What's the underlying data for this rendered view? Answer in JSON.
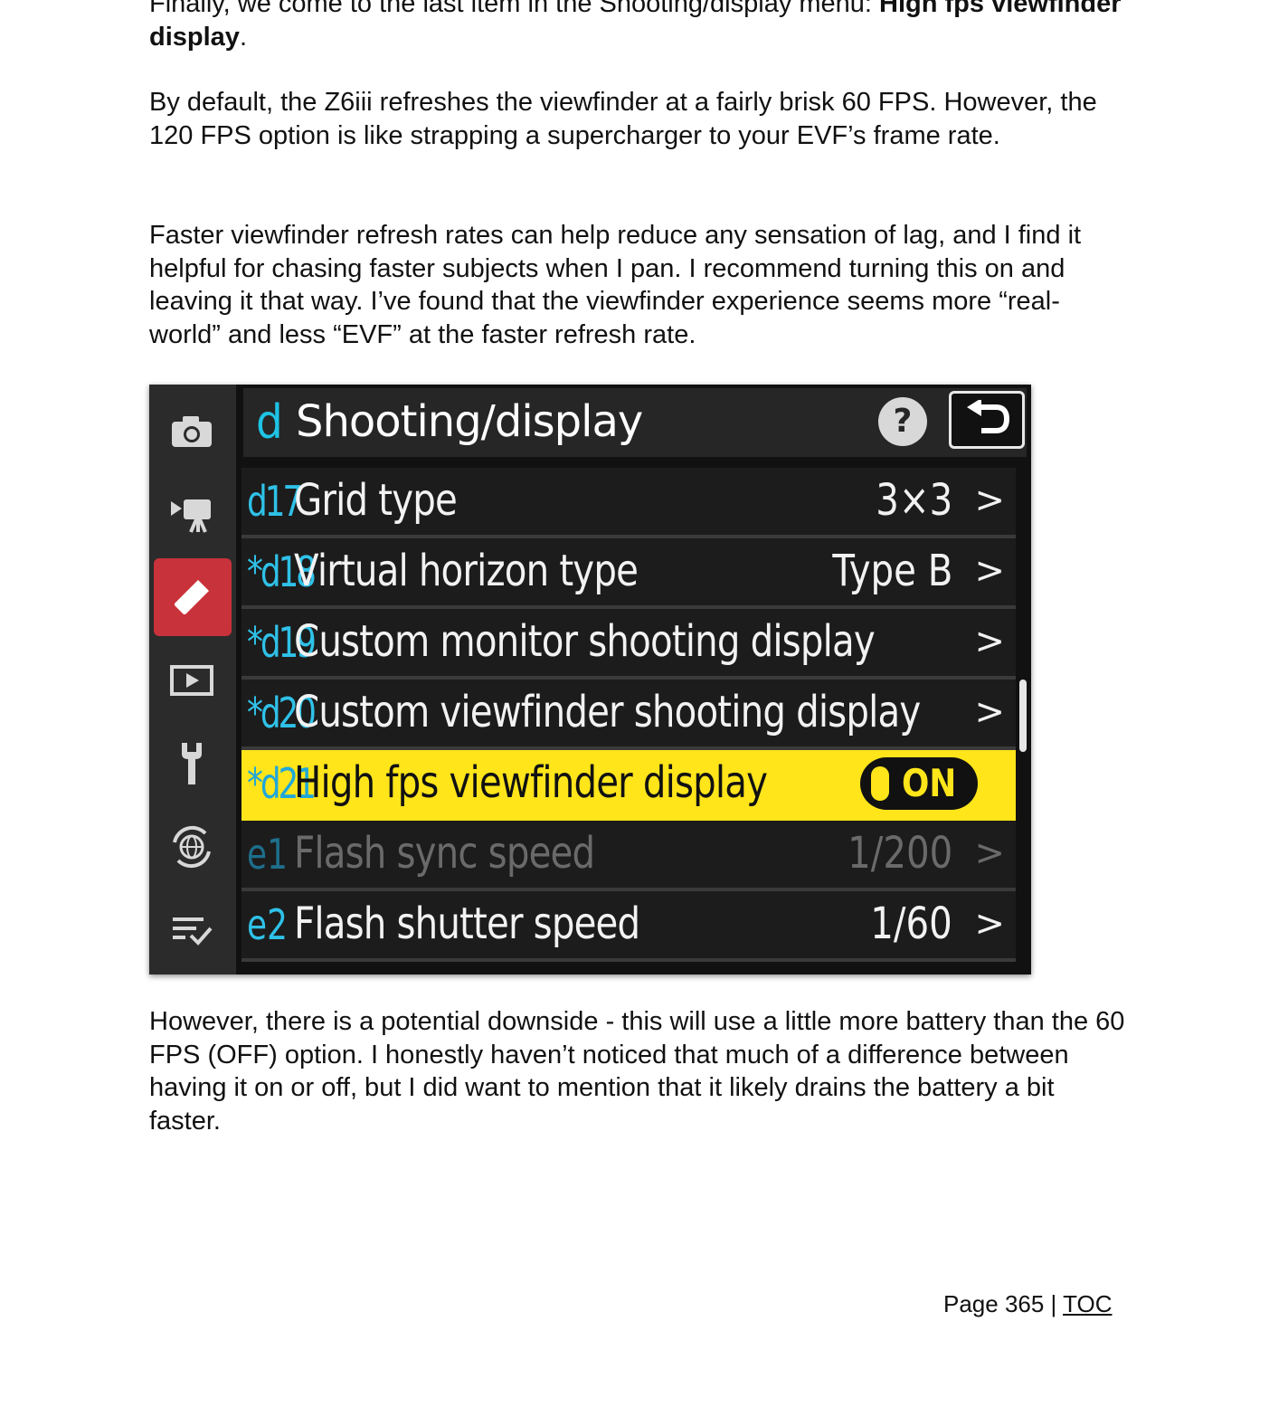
{
  "paragraphs": {
    "p0_pre": "Finally, we come to the last item in the Shooting/display menu: ",
    "p0_bold": "High fps viewfinder display",
    "p0_post": ".",
    "p1": "By default, the Z6iii refreshes the viewfinder at a fairly brisk 60 FPS. However, the 120 FPS option is like strapping a supercharger to your EVF’s frame rate.",
    "p2": "Faster viewfinder refresh rates can help reduce any sensation of lag, and I find it helpful for chasing faster subjects when I pan. I recommend turning this on and leaving it that way. I’ve found that the viewfinder experience seems more “real-world” and less “EVF” at the faster refresh rate.",
    "p3": "However, there is a potential downside - this will use a little more battery than the 60 FPS (OFF) option. I honestly haven’t noticed that much of a difference between having it on or off, but I did want to mention that it likely drains the battery a bit faster."
  },
  "menu": {
    "header_letter": "d",
    "header_title": "Shooting/display",
    "help_label": "?",
    "rail_icons": [
      "camera-icon",
      "movie-camera-icon",
      "pencil-icon",
      "playback-icon",
      "wrench-icon",
      "network-icon",
      "my-menu-icon"
    ],
    "active_rail_icon": "pencil-icon",
    "rows": [
      {
        "code": "d17",
        "label": "Grid type",
        "value": "3×3",
        "chevron": ">"
      },
      {
        "code": "*d18",
        "label": "Virtual horizon type",
        "value": "Type  B",
        "chevron": ">"
      },
      {
        "code": "*d19",
        "label": "Custom monitor shooting display",
        "value": "",
        "chevron": ">"
      },
      {
        "code": "*d20",
        "label": "Custom viewfinder shooting display",
        "value": "",
        "chevron": ">"
      },
      {
        "code": "*d21",
        "label": "High fps viewfinder display",
        "value": "ON",
        "selected": true
      },
      {
        "code": "e1",
        "label": "Flash sync speed",
        "value": "1/200",
        "chevron": ">",
        "dimmed": true
      },
      {
        "code": "e2",
        "label": "Flash shutter speed",
        "value": "1/60",
        "chevron": ">"
      }
    ],
    "colors": {
      "highlight": "#ffe51a",
      "code_cyan": "#2fc1e8",
      "active_tab": "#c8323a"
    }
  },
  "footer": {
    "page_label": "Page 365 | ",
    "toc_label": "TOC"
  }
}
